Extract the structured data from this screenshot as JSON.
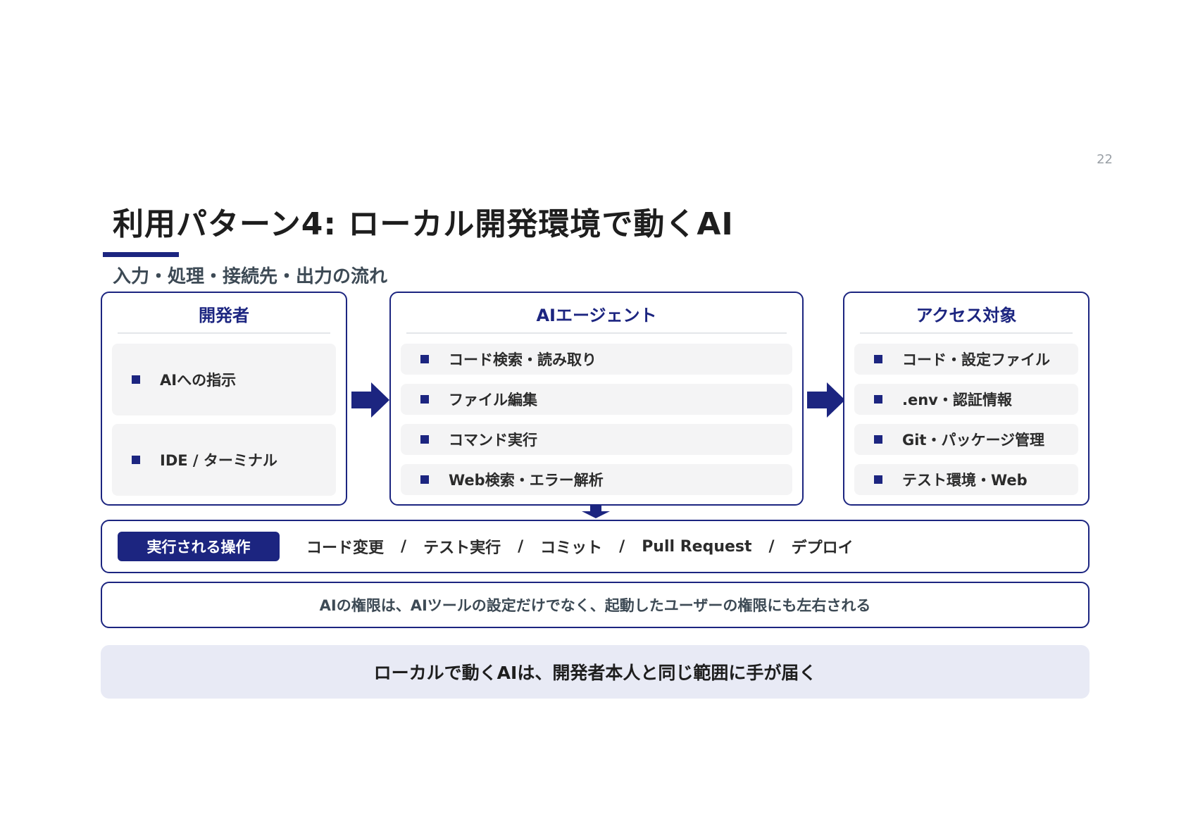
{
  "page_number": "22",
  "title": "利用パターン4: ローカル開発環境で動くAI",
  "subtitle": "入力・処理・接続先・出力の流れ",
  "colors": {
    "accent": "#1c2580",
    "item_bg": "#f4f4f5",
    "conclusion_bg": "#e8eaf5"
  },
  "panels": {
    "developer": {
      "title": "開発者",
      "items": [
        "AIへの指示",
        "IDE / ターミナル"
      ]
    },
    "agent": {
      "title": "AIエージェント",
      "items": [
        "コード検索・読み取り",
        "ファイル編集",
        "コマンド実行",
        "Web検索・エラー解析"
      ]
    },
    "targets": {
      "title": "アクセス対象",
      "items": [
        "コード・設定ファイル",
        ".env・認証情報",
        "Git・パッケージ管理",
        "テスト環境・Web"
      ]
    }
  },
  "operations": {
    "badge": "実行される操作",
    "items": [
      "コード変更",
      "テスト実行",
      "コミット",
      "Pull Request",
      "デプロイ"
    ],
    "separator": "/"
  },
  "note": "AIの権限は、AIツールの設定だけでなく、起動したユーザーの権限にも左右される",
  "conclusion": "ローカルで動くAIは、開発者本人と同じ範囲に手が届く",
  "icons": {
    "flow_arrow": "arrow-right-icon",
    "down_arrow": "arrow-down-icon",
    "bullet": "square-bullet-icon"
  }
}
